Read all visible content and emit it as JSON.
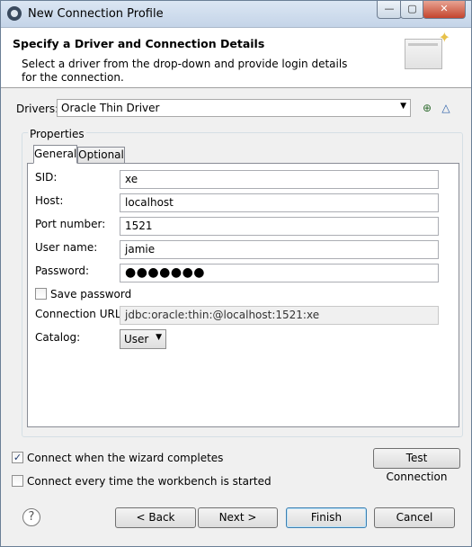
{
  "window": {
    "title": "New Connection Profile",
    "minimize_glyph": "—",
    "maximize_glyph": "▢",
    "close_glyph": "✕"
  },
  "banner": {
    "heading": "Specify a Driver and Connection Details",
    "description": "Select a driver from the drop-down and provide login details for the connection."
  },
  "drivers": {
    "label": "Drivers:",
    "selected": "Oracle Thin Driver",
    "new_driver_icon": "new-driver-icon",
    "edit_driver_icon": "edit-driver-icon"
  },
  "properties": {
    "group_label": "Properties",
    "tabs": [
      {
        "label": "General"
      },
      {
        "label": "Optional"
      }
    ],
    "fields": {
      "sid": {
        "label": "SID:",
        "value": "xe"
      },
      "host": {
        "label": "Host:",
        "value": "localhost"
      },
      "port": {
        "label": "Port number:",
        "value": "1521"
      },
      "user": {
        "label": "User name:",
        "value": "jamie"
      },
      "password": {
        "label": "Password:",
        "value": "●●●●●●●"
      },
      "save_password": {
        "label": "Save password",
        "checked": false
      },
      "url": {
        "label": "Connection URL:",
        "value": "jdbc:oracle:thin:@localhost:1521:xe"
      },
      "catalog": {
        "label": "Catalog:",
        "value": "User"
      }
    }
  },
  "options": {
    "connect_on_complete": {
      "label": "Connect when the wizard completes",
      "checked": true
    },
    "connect_every_time": {
      "label": "Connect every time the workbench is started",
      "checked": false
    }
  },
  "buttons": {
    "test_connection": "Test Connection",
    "back": "< Back",
    "next": "Next >",
    "finish": "Finish",
    "cancel": "Cancel",
    "help": "?"
  }
}
